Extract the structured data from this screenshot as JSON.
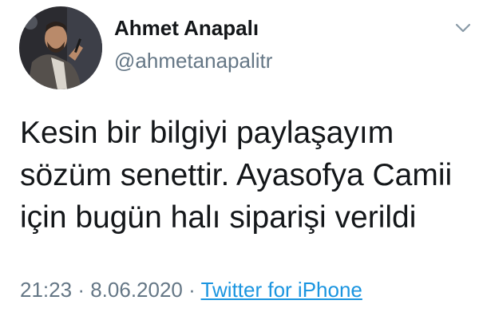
{
  "tweet": {
    "author": {
      "display_name": "Ahmet Anapalı",
      "handle": "@ahmetanapalitr",
      "avatar_icon": "profile-photo"
    },
    "menu_icon": "chevron-down-icon",
    "text_lines": [
      "Kesin bir bilgiyi paylaşayım",
      "sözüm senettir. Ayasofya Camii",
      "için bugün halı siparişi verildi"
    ],
    "time": "21:23",
    "separator": "·",
    "date": "8.06.2020",
    "source": "Twitter for iPhone"
  },
  "colors": {
    "text": "#14171a",
    "secondary": "#657786",
    "link": "#1b95e0"
  }
}
